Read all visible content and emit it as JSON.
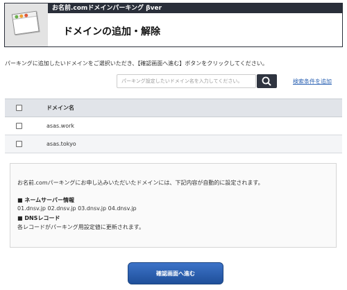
{
  "header": {
    "app_title": "お名前.comドメインパーキング βver",
    "page_title": "ドメインの追加・解除"
  },
  "colors": {
    "header_bar": "#2a2f3a",
    "accent_blue": "#2e64b4",
    "button_blue": "#2f5fae",
    "dot_green": "#6ab04c",
    "dot_orange": "#f0a030",
    "dot_red": "#e05a3a"
  },
  "icons": {
    "header": "browser-window-icon",
    "search": "search-icon"
  },
  "instruction": "パーキングに追加したいドメインをご選択いただき、【確認画面へ進む】ボタンをクリックしてください。",
  "search": {
    "placeholder": "パーキング設定したいドメイン名を入力してください。",
    "advanced_link": "検索条件を追加"
  },
  "table": {
    "header": "ドメイン名",
    "rows": [
      {
        "domain": "asas.work"
      },
      {
        "domain": "asas.tokyo"
      }
    ]
  },
  "info": {
    "intro": "お名前.comパーキングにお申し込みいただいたドメインには、下記内容が自動的に設定されます。",
    "ns_heading": "■ ネームサーバー情報",
    "ns_value": "01.dnsv.jp 02.dnsv.jp 03.dnsv.jp 04.dnsv.jp",
    "dns_heading": "■ DNSレコード",
    "dns_value": "各レコードがパーキング用設定値に更新されます。"
  },
  "confirm_button": "確認画面へ進む"
}
